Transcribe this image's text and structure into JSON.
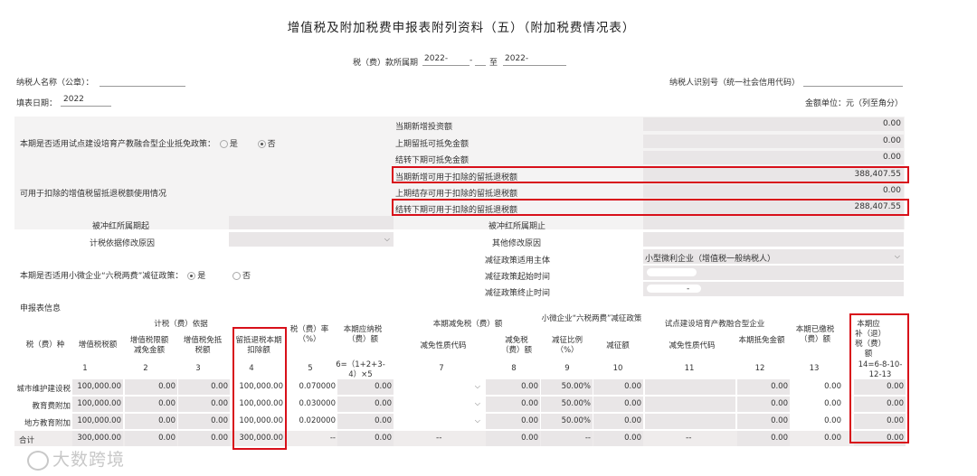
{
  "page": {
    "title": "增值税及附加税费申报表附列资料（五）（附加税费情况表）",
    "period_label": "税（费）款所属期",
    "period_from": "2022-",
    "period_sep1": "-",
    "period_to_label": "至",
    "period_to": "2022-",
    "taxpayer_name_label": "纳税人名称（公章）：",
    "taxpayer_id_label": "纳税人识别号（统一社会信用代码）",
    "fill_date_label": "填表日期：",
    "fill_date": "2022",
    "unit_label": "金额单位：元（列至角分）"
  },
  "pilot": {
    "question": "本期是否适用试点建设培育产教融合型企业抵免政策：",
    "yes": "是",
    "no": "否",
    "rows": [
      {
        "label": "当期新增投资额",
        "value": "0.00"
      },
      {
        "label": "上期留抵可抵免金额",
        "value": "0.00"
      },
      {
        "label": "结转下期可抵免金额",
        "value": "0.00"
      }
    ]
  },
  "refund": {
    "usage_label": "可用于扣除的增值税留抵退税额使用情况",
    "rows": [
      {
        "label": "当期新增可用于扣除的留抵退税额",
        "value": "388,407.55"
      },
      {
        "label": "上期结存可用于扣除的留抵退税额",
        "value": "0.00"
      },
      {
        "label": "结转下期可用于扣除的留抵退税额",
        "value": "288,407.55"
      }
    ]
  },
  "offset": {
    "left_label_1": "被冲红所属期起",
    "left_label_2": "计税依据修改原因",
    "right_label_1": "被冲红所属期止",
    "right_label_2": "其他修改原因"
  },
  "small": {
    "question": "本期是否适用小微企业“六税两费”减征政策：",
    "yes": "是",
    "no": "否",
    "subject_label": "减征政策适用主体",
    "subject_value": "小型微利企业（增值税一般纳税人）",
    "start_label": "减征政策起始时间",
    "end_label": "减征政策终止时间",
    "end_value": "-"
  },
  "table": {
    "section_label": "申报表信息",
    "headers": {
      "type": "税（费）种",
      "basis_group": "计税（费）依据",
      "vat": "增值税税额",
      "vat_exempt": "增值税限额减免金额",
      "vat_credit": "增值税免抵税额",
      "refund_deduct": "留抵退税本期扣除额",
      "rate": "税（费）率（%）",
      "payable": "本期应纳税（费）额",
      "relief_group": "本期减免税（费）额",
      "relief_code": "减免性质代码",
      "relief_amount": "减免税（费）额",
      "small_group": "小微企业“六税两费”减征政策",
      "small_ratio": "减征比例（%）",
      "small_amount": "减征额",
      "pilot_group": "试点建设培育产教融合型企业",
      "pilot_code": "减免性质代码",
      "pilot_amount": "本期抵免金额",
      "paid": "本期已缴税（费）额",
      "refund_due": "本期应补（退）税（费）额"
    },
    "col_numbers": [
      "1",
      "2",
      "3",
      "4",
      "5",
      "6=（1+2+3-4）×5",
      "7",
      "8",
      "9",
      "10",
      "11",
      "12",
      "13",
      "14=6-8-10-12-13"
    ],
    "rows": [
      {
        "name": "城市维护建设税",
        "vat": "100,000.00",
        "c2": "0.00",
        "c3": "0.00",
        "c4": "100,000.00",
        "rate": "0.070000",
        "payable": "0.00",
        "code": "",
        "relief": "0.00",
        "ratio": "50.00%",
        "small": "0.00",
        "pcode": "",
        "pilot": "0.00",
        "paid": "0.00",
        "due": "0.00"
      },
      {
        "name": "教育费附加",
        "vat": "100,000.00",
        "c2": "0.00",
        "c3": "0.00",
        "c4": "100,000.00",
        "rate": "0.030000",
        "payable": "0.00",
        "code": "",
        "relief": "0.00",
        "ratio": "50.00%",
        "small": "0.00",
        "pcode": "",
        "pilot": "0.00",
        "paid": "0.00",
        "due": "0.00"
      },
      {
        "name": "地方教育附加",
        "vat": "100,000.00",
        "c2": "0.00",
        "c3": "0.00",
        "c4": "100,000.00",
        "rate": "0.020000",
        "payable": "0.00",
        "code": "",
        "relief": "0.00",
        "ratio": "50.00%",
        "small": "0.00",
        "pcode": "",
        "pilot": "0.00",
        "paid": "0.00",
        "due": "0.00"
      }
    ],
    "total": {
      "name": "合计",
      "vat": "300,000.00",
      "c2": "0.00",
      "c3": "0.00",
      "c4": "300,000.00",
      "rate": "--",
      "payable": "0.00",
      "code": "--",
      "relief": "0.00",
      "ratio": "--",
      "small": "0.00",
      "pcode": "--",
      "pilot": "0.00",
      "paid": "0.00",
      "due": "0.00"
    }
  },
  "watermark": "大数跨境"
}
